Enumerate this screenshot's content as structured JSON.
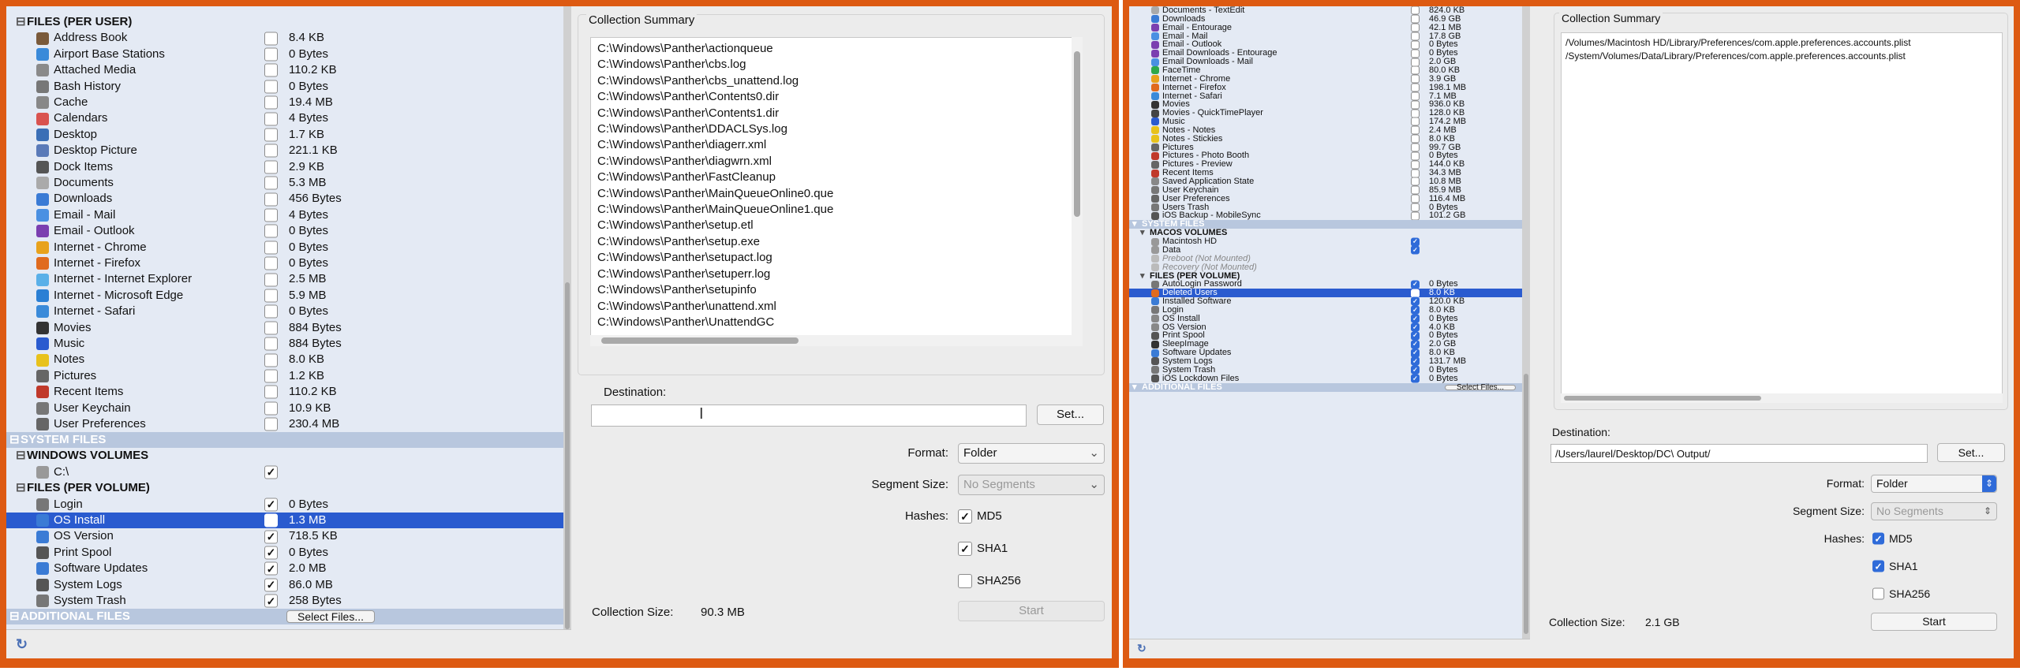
{
  "left": {
    "hdr_files_per_user": "FILES (PER USER)",
    "user_files": [
      {
        "name": "Address Book",
        "size": "8.4 KB",
        "checked": false,
        "color": "#7a5a3a"
      },
      {
        "name": "Airport Base Stations",
        "size": "0 Bytes",
        "checked": false,
        "color": "#3a8ad9"
      },
      {
        "name": "Attached Media",
        "size": "110.2 KB",
        "checked": false,
        "color": "#8a8a8a"
      },
      {
        "name": "Bash History",
        "size": "0 Bytes",
        "checked": false,
        "color": "#777"
      },
      {
        "name": "Cache",
        "size": "19.4 MB",
        "checked": false,
        "color": "#888"
      },
      {
        "name": "Calendars",
        "size": "4 Bytes",
        "checked": false,
        "color": "#d9534f"
      },
      {
        "name": "Desktop",
        "size": "1.7 KB",
        "checked": false,
        "color": "#3b6fb6"
      },
      {
        "name": "Desktop Picture",
        "size": "221.1 KB",
        "checked": false,
        "color": "#5a7ab8"
      },
      {
        "name": "Dock Items",
        "size": "2.9 KB",
        "checked": false,
        "color": "#555"
      },
      {
        "name": "Documents",
        "size": "5.3 MB",
        "checked": false,
        "color": "#aaa"
      },
      {
        "name": "Downloads",
        "size": "456 Bytes",
        "checked": false,
        "color": "#3a7bd5"
      },
      {
        "name": "Email - Mail",
        "size": "4 Bytes",
        "checked": false,
        "color": "#4a90e2"
      },
      {
        "name": "Email - Outlook",
        "size": "0 Bytes",
        "checked": false,
        "color": "#7b3fb0"
      },
      {
        "name": "Internet - Chrome",
        "size": "0 Bytes",
        "checked": false,
        "color": "#e8a21c"
      },
      {
        "name": "Internet - Firefox",
        "size": "0 Bytes",
        "checked": false,
        "color": "#e06b1f"
      },
      {
        "name": "Internet - Internet Explorer",
        "size": "2.5 MB",
        "checked": false,
        "color": "#5ab0e8"
      },
      {
        "name": "Internet - Microsoft Edge",
        "size": "5.9 MB",
        "checked": false,
        "color": "#2a7fd4"
      },
      {
        "name": "Internet - Safari",
        "size": "0 Bytes",
        "checked": false,
        "color": "#3a8ad9"
      },
      {
        "name": "Movies",
        "size": "884 Bytes",
        "checked": false,
        "color": "#333"
      },
      {
        "name": "Music",
        "size": "884 Bytes",
        "checked": false,
        "color": "#2a5bcf"
      },
      {
        "name": "Notes",
        "size": "8.0 KB",
        "checked": false,
        "color": "#e8c21c"
      },
      {
        "name": "Pictures",
        "size": "1.2 KB",
        "checked": false,
        "color": "#666"
      },
      {
        "name": "Recent Items",
        "size": "110.2 KB",
        "checked": false,
        "color": "#c0392b"
      },
      {
        "name": "User Keychain",
        "size": "10.9 KB",
        "checked": false,
        "color": "#777"
      },
      {
        "name": "User Preferences",
        "size": "230.4 MB",
        "checked": false,
        "color": "#666"
      }
    ],
    "band_system_files": "SYSTEM FILES",
    "hdr_windows_volumes": "WINDOWS VOLUMES",
    "volumes": [
      {
        "name": "C:\\",
        "checked": true,
        "color": "#999"
      }
    ],
    "hdr_files_per_volume": "FILES (PER VOLUME)",
    "volume_files": [
      {
        "name": "Login",
        "size": "0 Bytes",
        "checked": true,
        "sel": false,
        "color": "#777"
      },
      {
        "name": "OS Install",
        "size": "1.3 MB",
        "checked": true,
        "sel": true,
        "color": "#3a7bd5"
      },
      {
        "name": "OS Version",
        "size": "718.5 KB",
        "checked": true,
        "sel": false,
        "color": "#3a7bd5"
      },
      {
        "name": "Print Spool",
        "size": "0 Bytes",
        "checked": true,
        "sel": false,
        "color": "#555"
      },
      {
        "name": "Software Updates",
        "size": "2.0 MB",
        "checked": true,
        "sel": false,
        "color": "#3a7bd5"
      },
      {
        "name": "System Logs",
        "size": "86.0 MB",
        "checked": true,
        "sel": false,
        "color": "#555"
      },
      {
        "name": "System Trash",
        "size": "258 Bytes",
        "checked": true,
        "sel": false,
        "color": "#777"
      }
    ],
    "band_additional_files": "ADDITIONAL FILES",
    "select_files": "Select Files...",
    "summary_title": "Collection Summary",
    "summary_paths": [
      "C:\\Windows\\Panther\\actionqueue",
      "C:\\Windows\\Panther\\cbs.log",
      "C:\\Windows\\Panther\\cbs_unattend.log",
      "C:\\Windows\\Panther\\Contents0.dir",
      "C:\\Windows\\Panther\\Contents1.dir",
      "C:\\Windows\\Panther\\DDACLSys.log",
      "C:\\Windows\\Panther\\diagerr.xml",
      "C:\\Windows\\Panther\\diagwrn.xml",
      "C:\\Windows\\Panther\\FastCleanup",
      "C:\\Windows\\Panther\\MainQueueOnline0.que",
      "C:\\Windows\\Panther\\MainQueueOnline1.que",
      "C:\\Windows\\Panther\\setup.etl",
      "C:\\Windows\\Panther\\setup.exe",
      "C:\\Windows\\Panther\\setupact.log",
      "C:\\Windows\\Panther\\setuperr.log",
      "C:\\Windows\\Panther\\setupinfo",
      "C:\\Windows\\Panther\\unattend.xml",
      "C:\\Windows\\Panther\\UnattendGC"
    ],
    "destination_label": "Destination:",
    "destination_value": "",
    "set_button": "Set...",
    "format_label": "Format:",
    "format_value": "Folder",
    "segment_label": "Segment Size:",
    "segment_value": "No Segments",
    "hashes_label": "Hashes:",
    "md5": "MD5",
    "md5_checked": true,
    "sha1": "SHA1",
    "sha1_checked": true,
    "sha256": "SHA256",
    "sha256_checked": false,
    "collection_size_label": "Collection Size:",
    "collection_size_value": "90.3 MB",
    "start_button": "Start"
  },
  "right": {
    "user_files": [
      {
        "name": "Documents - TextEdit",
        "size": "824.0 KB",
        "checked": false,
        "color": "#aaa"
      },
      {
        "name": "Downloads",
        "size": "46.9 GB",
        "checked": false,
        "color": "#3a7bd5"
      },
      {
        "name": "Email - Entourage",
        "size": "42.1 MB",
        "checked": false,
        "color": "#7b3fb0"
      },
      {
        "name": "Email - Mail",
        "size": "17.8 GB",
        "checked": false,
        "color": "#4a90e2"
      },
      {
        "name": "Email - Outlook",
        "size": "0 Bytes",
        "checked": false,
        "color": "#7b3fb0"
      },
      {
        "name": "Email Downloads - Entourage",
        "size": "0 Bytes",
        "checked": false,
        "color": "#7b3fb0"
      },
      {
        "name": "Email Downloads - Mail",
        "size": "2.0 GB",
        "checked": false,
        "color": "#4a90e2"
      },
      {
        "name": "FaceTime",
        "size": "80.0 KB",
        "checked": false,
        "color": "#2ea84a"
      },
      {
        "name": "Internet - Chrome",
        "size": "3.9 GB",
        "checked": false,
        "color": "#e8a21c"
      },
      {
        "name": "Internet - Firefox",
        "size": "198.1 MB",
        "checked": false,
        "color": "#e06b1f"
      },
      {
        "name": "Internet - Safari",
        "size": "7.1 MB",
        "checked": false,
        "color": "#3a8ad9"
      },
      {
        "name": "Movies",
        "size": "936.0 KB",
        "checked": false,
        "color": "#333"
      },
      {
        "name": "Movies - QuickTimePlayer",
        "size": "128.0 KB",
        "checked": false,
        "color": "#444"
      },
      {
        "name": "Music",
        "size": "174.2 MB",
        "checked": false,
        "color": "#2a5bcf"
      },
      {
        "name": "Notes - Notes",
        "size": "2.4 MB",
        "checked": false,
        "color": "#e8c21c"
      },
      {
        "name": "Notes - Stickies",
        "size": "8.0 KB",
        "checked": false,
        "color": "#e8c21c"
      },
      {
        "name": "Pictures",
        "size": "99.7 GB",
        "checked": false,
        "color": "#666"
      },
      {
        "name": "Pictures - Photo Booth",
        "size": "0 Bytes",
        "checked": false,
        "color": "#c0392b"
      },
      {
        "name": "Pictures - Preview",
        "size": "144.0 KB",
        "checked": false,
        "color": "#666"
      },
      {
        "name": "Recent Items",
        "size": "34.3 MB",
        "checked": false,
        "color": "#c0392b"
      },
      {
        "name": "Saved Application State",
        "size": "10.8 MB",
        "checked": false,
        "color": "#888"
      },
      {
        "name": "User Keychain",
        "size": "85.9 MB",
        "checked": false,
        "color": "#777"
      },
      {
        "name": "User Preferences",
        "size": "116.4 MB",
        "checked": false,
        "color": "#666"
      },
      {
        "name": "Users Trash",
        "size": "0 Bytes",
        "checked": false,
        "color": "#777"
      },
      {
        "name": "iOS Backup - MobileSync",
        "size": "101.2 GB",
        "checked": false,
        "color": "#555"
      }
    ],
    "band_system_files": "SYSTEM FILES",
    "hdr_macos_volumes": "MACOS VOLUMES",
    "volumes": [
      {
        "name": "Macintosh HD",
        "checked": true,
        "mounted": true,
        "color": "#999"
      },
      {
        "name": "Data",
        "checked": true,
        "mounted": true,
        "color": "#999"
      },
      {
        "name": "Preboot (Not Mounted)",
        "checked": false,
        "mounted": false,
        "color": "#bbb"
      },
      {
        "name": "Recovery (Not Mounted)",
        "checked": false,
        "mounted": false,
        "color": "#bbb"
      }
    ],
    "hdr_files_per_volume": "FILES (PER VOLUME)",
    "volume_files": [
      {
        "name": "AutoLogin Password",
        "size": "0 Bytes",
        "checked": true,
        "sel": false,
        "color": "#777"
      },
      {
        "name": "Deleted Users",
        "size": "8.0 KB",
        "checked": true,
        "sel": true,
        "color": "#e06b1f"
      },
      {
        "name": "Installed Software",
        "size": "120.0 KB",
        "checked": true,
        "sel": false,
        "color": "#3a7bd5"
      },
      {
        "name": "Login",
        "size": "8.0 KB",
        "checked": true,
        "sel": false,
        "color": "#777"
      },
      {
        "name": "OS Install",
        "size": "0 Bytes",
        "checked": true,
        "sel": false,
        "color": "#888"
      },
      {
        "name": "OS Version",
        "size": "4.0 KB",
        "checked": true,
        "sel": false,
        "color": "#888"
      },
      {
        "name": "Print Spool",
        "size": "0 Bytes",
        "checked": true,
        "sel": false,
        "color": "#555"
      },
      {
        "name": "SleepImage",
        "size": "2.0 GB",
        "checked": true,
        "sel": false,
        "color": "#333"
      },
      {
        "name": "Software Updates",
        "size": "8.0 KB",
        "checked": true,
        "sel": false,
        "color": "#3a7bd5"
      },
      {
        "name": "System Logs",
        "size": "131.7 MB",
        "checked": true,
        "sel": false,
        "color": "#555"
      },
      {
        "name": "System Trash",
        "size": "0 Bytes",
        "checked": true,
        "sel": false,
        "color": "#777"
      },
      {
        "name": "iOS Lockdown Files",
        "size": "0 Bytes",
        "checked": true,
        "sel": false,
        "color": "#555"
      }
    ],
    "band_additional_files": "ADDITIONAL FILES",
    "select_files": "Select Files...",
    "summary_title": "Collection Summary",
    "summary_paths": [
      "/Volumes/Macintosh HD/Library/Preferences/com.apple.preferences.accounts.plist",
      "/System/Volumes/Data/Library/Preferences/com.apple.preferences.accounts.plist"
    ],
    "destination_label": "Destination:",
    "destination_value": "/Users/laurel/Desktop/DC\\ Output/",
    "set_button": "Set...",
    "format_label": "Format:",
    "format_value": "Folder",
    "segment_label": "Segment Size:",
    "segment_value": "No Segments",
    "hashes_label": "Hashes:",
    "md5": "MD5",
    "md5_checked": true,
    "sha1": "SHA1",
    "sha1_checked": true,
    "sha256": "SHA256",
    "sha256_checked": false,
    "collection_size_label": "Collection Size:",
    "collection_size_value": "2.1 GB",
    "start_button": "Start"
  }
}
